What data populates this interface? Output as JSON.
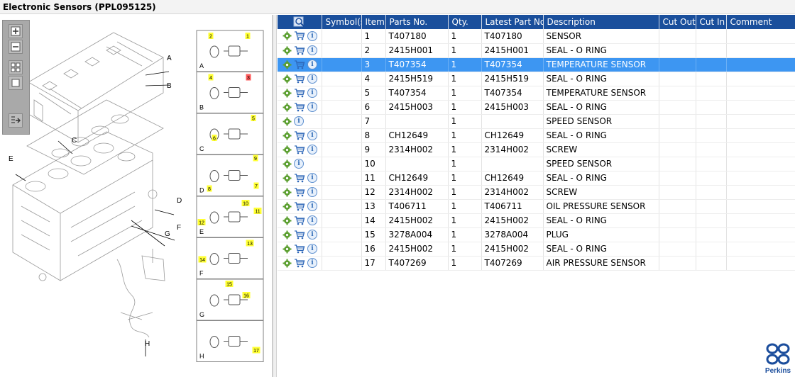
{
  "window": {
    "title": "Electronic Sensors (PPL095125)"
  },
  "colors": {
    "header_bg": "#1a4f9c",
    "selected_row_bg": "#3d96f2",
    "callout_yellow": "#ffff33",
    "callout_red": "#ff5a5a",
    "logo_blue": "#1b4d9c"
  },
  "toolbox": {
    "buttons": [
      {
        "name": "zoom-in-icon"
      },
      {
        "name": "zoom-out-icon"
      },
      {
        "name": "fit-page-icon"
      },
      {
        "name": "actual-size-icon"
      },
      {
        "name": "export-icon"
      }
    ]
  },
  "diagram": {
    "main_labels": [
      "A",
      "B",
      "C",
      "D",
      "E",
      "F",
      "G",
      "H"
    ],
    "panels": [
      {
        "letter": "A",
        "callouts": [
          {
            "n": "2"
          },
          {
            "n": "1"
          }
        ]
      },
      {
        "letter": "B",
        "callouts": [
          {
            "n": "4"
          },
          {
            "n": "3",
            "highlight": "red"
          }
        ]
      },
      {
        "letter": "C",
        "callouts": [
          {
            "n": "6"
          },
          {
            "n": "5"
          }
        ]
      },
      {
        "letter": "D",
        "callouts": [
          {
            "n": "8"
          },
          {
            "n": "9"
          },
          {
            "n": "7"
          }
        ]
      },
      {
        "letter": "E",
        "callouts": [
          {
            "n": "12"
          },
          {
            "n": "10"
          },
          {
            "n": "11"
          }
        ]
      },
      {
        "letter": "F",
        "callouts": [
          {
            "n": "14"
          },
          {
            "n": "13"
          }
        ]
      },
      {
        "letter": "G",
        "callouts": [
          {
            "n": "15"
          },
          {
            "n": "16"
          }
        ]
      },
      {
        "letter": "H",
        "callouts": [
          {
            "n": "17"
          }
        ]
      }
    ]
  },
  "table": {
    "columns": [
      "Symbol(s)",
      "Item",
      "Parts No.",
      "Qty.",
      "Latest Part No.",
      "Description",
      "Cut Out",
      "Cut In",
      "Comment"
    ],
    "header_icon": "find-in-diagram-icon",
    "selected_item": "3",
    "rows": [
      {
        "item": "1",
        "part_no": "T407180",
        "qty": "1",
        "latest": "T407180",
        "desc": "SENSOR",
        "cart": true
      },
      {
        "item": "2",
        "part_no": "2415H001",
        "qty": "1",
        "latest": "2415H001",
        "desc": "SEAL - O RING",
        "cart": true
      },
      {
        "item": "3",
        "part_no": "T407354",
        "qty": "1",
        "latest": "T407354",
        "desc": "TEMPERATURE SENSOR",
        "cart": true
      },
      {
        "item": "4",
        "part_no": "2415H519",
        "qty": "1",
        "latest": "2415H519",
        "desc": "SEAL - O RING",
        "cart": true
      },
      {
        "item": "5",
        "part_no": "T407354",
        "qty": "1",
        "latest": "T407354",
        "desc": "TEMPERATURE SENSOR",
        "cart": true
      },
      {
        "item": "6",
        "part_no": "2415H003",
        "qty": "1",
        "latest": "2415H003",
        "desc": "SEAL - O RING",
        "cart": true
      },
      {
        "item": "7",
        "part_no": "",
        "qty": "1",
        "latest": "",
        "desc": "SPEED SENSOR",
        "cart": false
      },
      {
        "item": "8",
        "part_no": "CH12649",
        "qty": "1",
        "latest": "CH12649",
        "desc": "SEAL - O RING",
        "cart": true
      },
      {
        "item": "9",
        "part_no": "2314H002",
        "qty": "1",
        "latest": "2314H002",
        "desc": "SCREW",
        "cart": true
      },
      {
        "item": "10",
        "part_no": "",
        "qty": "1",
        "latest": "",
        "desc": "SPEED SENSOR",
        "cart": false
      },
      {
        "item": "11",
        "part_no": "CH12649",
        "qty": "1",
        "latest": "CH12649",
        "desc": "SEAL - O RING",
        "cart": true
      },
      {
        "item": "12",
        "part_no": "2314H002",
        "qty": "1",
        "latest": "2314H002",
        "desc": "SCREW",
        "cart": true
      },
      {
        "item": "13",
        "part_no": "T406711",
        "qty": "1",
        "latest": "T406711",
        "desc": "OIL PRESSURE SENSOR",
        "cart": true
      },
      {
        "item": "14",
        "part_no": "2415H002",
        "qty": "1",
        "latest": "2415H002",
        "desc": "SEAL - O RING",
        "cart": true
      },
      {
        "item": "15",
        "part_no": "3278A004",
        "qty": "1",
        "latest": "3278A004",
        "desc": "PLUG",
        "cart": true
      },
      {
        "item": "16",
        "part_no": "2415H002",
        "qty": "1",
        "latest": "2415H002",
        "desc": "SEAL - O RING",
        "cart": true
      },
      {
        "item": "17",
        "part_no": "T407269",
        "qty": "1",
        "latest": "T407269",
        "desc": "AIR PRESSURE SENSOR",
        "cart": true
      }
    ]
  },
  "brand": {
    "name": "Perkins"
  }
}
